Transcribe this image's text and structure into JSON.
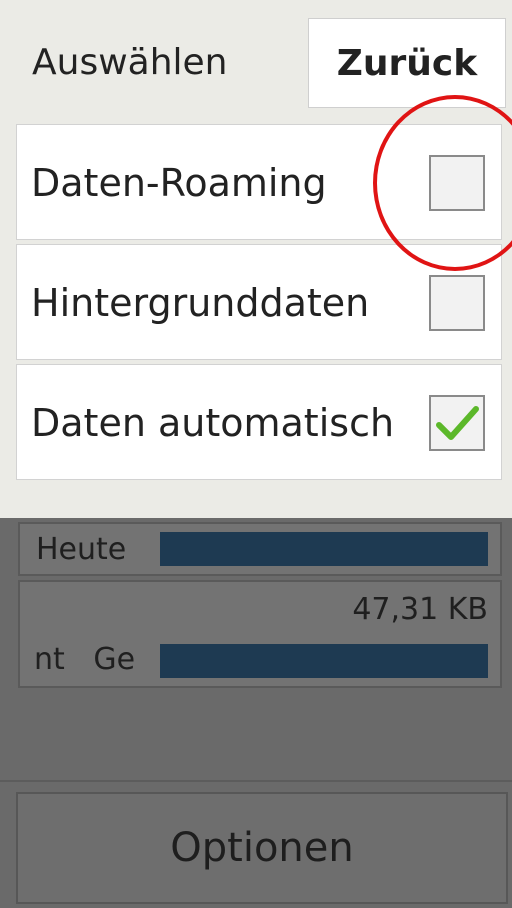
{
  "dialog": {
    "title": "Auswählen",
    "back_label": "Zurück",
    "options": [
      {
        "label": "Daten-Roaming",
        "checked": false
      },
      {
        "label": "Hintergrunddaten",
        "checked": false
      },
      {
        "label": "Daten automatisch",
        "checked": true
      }
    ]
  },
  "background": {
    "today_label": "Heute",
    "total_value": "47,31 KB",
    "total_label_fragment": "nt   Ge",
    "options_label": "Optionen"
  },
  "colors": {
    "bar": "#1e3a52",
    "checkmark": "#5cb82a",
    "highlight": "#e01414"
  }
}
